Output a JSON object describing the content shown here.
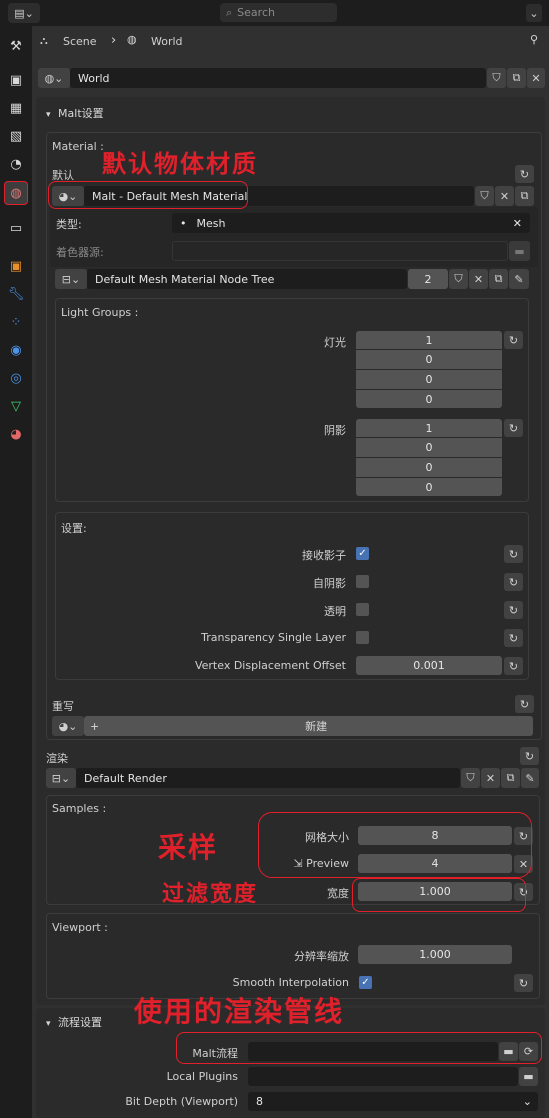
{
  "top": {
    "search_placeholder": "Search"
  },
  "breadcrumb": {
    "scene": "Scene",
    "world": "World"
  },
  "world_selector": {
    "value": "World"
  },
  "malt": {
    "title": "Malt设置",
    "material_label": "Material :",
    "default_label": "默认",
    "default_material": "Malt - Default Mesh Material",
    "type_label": "类型:",
    "type_value": "Mesh",
    "shader_source_label": "着色器源:",
    "node_tree": "Default Mesh Material Node Tree",
    "node_tree_users": "2",
    "light_groups_label": "Light Groups :",
    "light_label": "灯光",
    "light_values": [
      "1",
      "0",
      "0",
      "0"
    ],
    "shadow_label": "阴影",
    "shadow_values": [
      "1",
      "0",
      "0",
      "0"
    ],
    "settings_label": "设置:",
    "receive_shadow": "接收影子",
    "self_shadow": "自阴影",
    "transparency": "透明",
    "transparency_single_layer": "Transparency Single Layer",
    "vertex_displacement_offset": "Vertex Displacement Offset",
    "vertex_displacement_value": "0.001",
    "override_label": "重写",
    "new_button": "新建",
    "render_label": "渲染",
    "render_value": "Default Render",
    "samples_label": "Samples :",
    "grid_size_label": "网格大小",
    "grid_size_value": "8",
    "preview_label": "Preview",
    "preview_value": "4",
    "width_label": "宽度",
    "width_value": "1.000",
    "viewport_label": "Viewport :",
    "resolution_scale_label": "分辨率缩放",
    "resolution_scale_value": "1.000",
    "smooth_interpolation_label": "Smooth Interpolation"
  },
  "pipeline": {
    "title": "流程设置",
    "malt_pipeline_label": "Malt流程",
    "local_plugins_label": "Local Plugins",
    "bit_depth_label": "Bit Depth (Viewport)",
    "bit_depth_value": "8"
  },
  "annotations": {
    "default_material": "默认物体材质",
    "sampling": "采样",
    "filter_width": "过滤宽度",
    "pipeline_used": "使用的渲染管线"
  },
  "colors": {
    "annotation_red": "#e0202a",
    "checkbox_blue": "#4772b3"
  }
}
